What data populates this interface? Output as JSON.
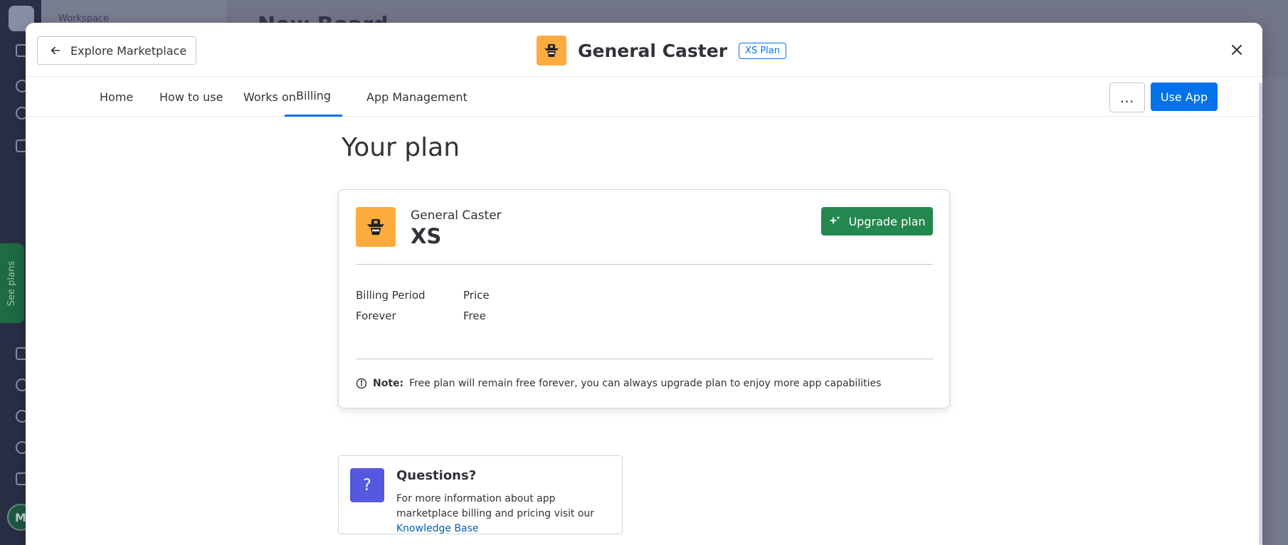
{
  "background": {
    "workspace_label": "Workspace",
    "board_title": "New Board",
    "see_plans": "See plans",
    "avatar_initial": "M"
  },
  "header": {
    "explore_label": "Explore Marketplace",
    "app_name": "General Caster",
    "plan_badge": "XS Plan"
  },
  "tabs": [
    {
      "label": "Home"
    },
    {
      "label": "How to use"
    },
    {
      "label": "Works on"
    },
    {
      "label": "Billing",
      "active": true
    },
    {
      "label": "App Management"
    }
  ],
  "actions": {
    "more_label": "…",
    "use_app_label": "Use App"
  },
  "main": {
    "heading": "Your plan",
    "plan_card": {
      "app_name": "General Caster",
      "plan_name": "XS",
      "upgrade_label": "Upgrade plan",
      "billing_period_label": "Billing Period",
      "billing_period_value": "Forever",
      "price_label": "Price",
      "price_value": "Free",
      "note_label": "Note:",
      "note_text": "Free plan will remain free forever, you can always upgrade plan to enjoy more app capabilities"
    },
    "questions": {
      "icon": "?",
      "title": "Questions?",
      "text": "For more information about app marketplace billing and pricing visit our",
      "link": "Knowledge Base"
    }
  },
  "colors": {
    "primary": "#0073ea",
    "upgrade_green": "#258750",
    "app_logo_bg": "#fdab3d",
    "questions_icon_bg": "#5559df"
  }
}
